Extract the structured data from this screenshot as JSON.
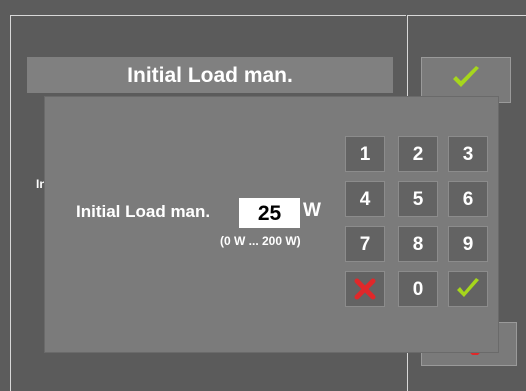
{
  "background": {
    "title": "Initial Load man.",
    "cut_text": "In",
    "confirm_icon": "check-icon",
    "bottom_icon": "cross-icon"
  },
  "dialog": {
    "field_label": "Initial Load man.",
    "value": "25",
    "unit": "W",
    "range": "(0 W ... 200 W)"
  },
  "keypad": {
    "keys": [
      "1",
      "2",
      "3",
      "4",
      "5",
      "6",
      "7",
      "8",
      "9",
      "0"
    ],
    "cancel_icon": "cross-icon",
    "ok_icon": "check-icon"
  },
  "colors": {
    "check": "#a6d61c",
    "cross": "#e0282a"
  }
}
